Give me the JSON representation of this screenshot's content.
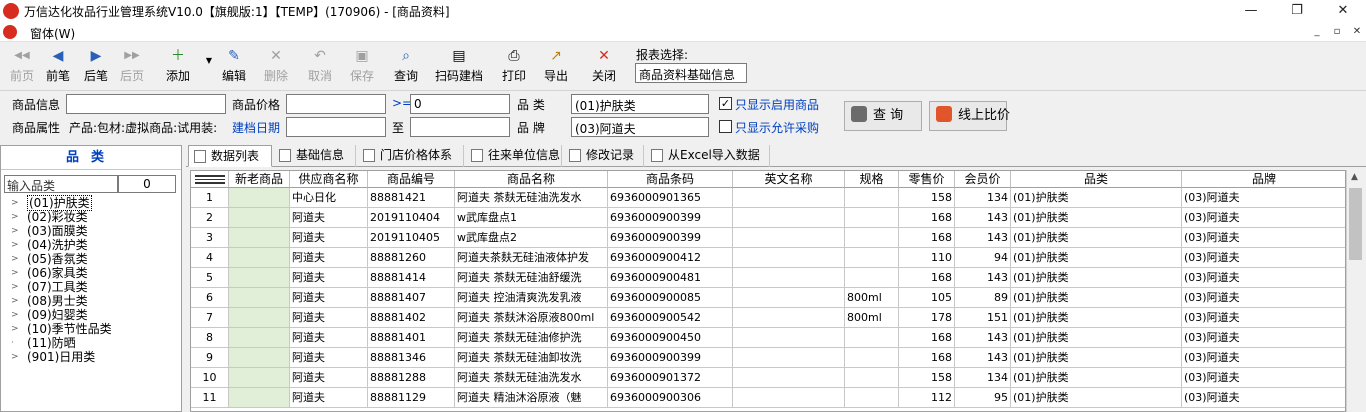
{
  "window": {
    "title": "万信达化妆品行业管理系统V10.0【旗舰版:1】【TEMP】(170906) - [商品资料]",
    "menu": "窗体(W)"
  },
  "toolbar": {
    "buttons": [
      {
        "label": "前页",
        "icon": "◀◀",
        "enabled": false
      },
      {
        "label": "前笔",
        "icon": "◀",
        "enabled": true
      },
      {
        "label": "后笔",
        "icon": "▶",
        "enabled": true
      },
      {
        "label": "后页",
        "icon": "▶▶",
        "enabled": false
      },
      {
        "label": "添加",
        "icon": "＋",
        "enabled": true
      },
      {
        "label": "编辑",
        "icon": "✎",
        "enabled": true
      },
      {
        "label": "删除",
        "icon": "✕",
        "enabled": false
      },
      {
        "label": "取消",
        "icon": "↶",
        "enabled": false
      },
      {
        "label": "保存",
        "icon": "▣",
        "enabled": false
      },
      {
        "label": "查询",
        "icon": "⌕",
        "enabled": true
      },
      {
        "label": "扫码建档",
        "icon": "▤",
        "enabled": true
      },
      {
        "label": "打印",
        "icon": "⎙",
        "enabled": true
      },
      {
        "label": "导出",
        "icon": "↗",
        "enabled": true
      },
      {
        "label": "关闭",
        "icon": "✕",
        "enabled": true
      }
    ],
    "report_label": "报表选择:",
    "report_value": "商品资料基础信息"
  },
  "filter": {
    "product_info_label": "商品信息",
    "product_info_value": "",
    "price_label": "商品价格",
    "price_value": "",
    "price_op": ">=",
    "price_min": "0",
    "category_label": "品      类",
    "category_value": "(01)护肤类",
    "only_enabled_label": "只显示启用商品",
    "only_enabled_checked": true,
    "attr_label": "商品属性",
    "attr_value": "产品:包材:虚拟商品:试用装:",
    "created_label": "建档日期",
    "created_from": "",
    "to_label": "至",
    "created_to": "",
    "brand_label": "品      牌",
    "brand_value": "(03)阿道夫",
    "only_purchase_label": "只显示允许采购",
    "only_purchase_checked": false,
    "query_button": "查  询",
    "compare_button": "线上比价"
  },
  "category_tree": {
    "header": "品类",
    "search_placeholder": "输入品类",
    "count": "0",
    "items": [
      {
        "label": "(01)护肤类",
        "selected": true,
        "expandable": true
      },
      {
        "label": "(02)彩妆类",
        "selected": false,
        "expandable": true
      },
      {
        "label": "(03)面膜类",
        "selected": false,
        "expandable": true
      },
      {
        "label": "(04)洗护类",
        "selected": false,
        "expandable": true
      },
      {
        "label": "(05)香氛类",
        "selected": false,
        "expandable": true
      },
      {
        "label": "(06)家具类",
        "selected": false,
        "expandable": true
      },
      {
        "label": "(07)工具类",
        "selected": false,
        "expandable": true
      },
      {
        "label": "(08)男士类",
        "selected": false,
        "expandable": true
      },
      {
        "label": "(09)妇婴类",
        "selected": false,
        "expandable": true
      },
      {
        "label": "(10)季节性品类",
        "selected": false,
        "expandable": true
      },
      {
        "label": "(11)防晒",
        "selected": false,
        "expandable": false
      },
      {
        "label": "(901)日用类",
        "selected": false,
        "expandable": true
      }
    ]
  },
  "tabs": [
    {
      "label": "数据列表",
      "active": true
    },
    {
      "label": "基础信息",
      "active": false
    },
    {
      "label": "门店价格体系",
      "active": false
    },
    {
      "label": "往来单位信息",
      "active": false
    },
    {
      "label": "修改记录",
      "active": false
    },
    {
      "label": "从Excel导入数据",
      "active": false
    }
  ],
  "table": {
    "columns": [
      "",
      "新老商品",
      "供应商名称",
      "商品编号",
      "商品名称",
      "商品条码",
      "英文名称",
      "规格",
      "零售价",
      "会员价",
      "品类",
      "品牌"
    ],
    "rows": [
      [
        "1",
        "",
        "中心日化",
        "88881421",
        "阿道夫 茶麸无硅油洗发水",
        "6936000901365",
        "",
        "",
        "158",
        "134",
        "(01)护肤类",
        "(03)阿道夫"
      ],
      [
        "2",
        "",
        "阿道夫",
        "2019110404",
        "w武库盘点1",
        "6936000900399",
        "",
        "",
        "168",
        "143",
        "(01)护肤类",
        "(03)阿道夫"
      ],
      [
        "3",
        "",
        "阿道夫",
        "2019110405",
        "w武库盘点2",
        "6936000900399",
        "",
        "",
        "168",
        "143",
        "(01)护肤类",
        "(03)阿道夫"
      ],
      [
        "4",
        "",
        "阿道夫",
        "88881260",
        "阿道夫茶麸无硅油液体护发",
        "6936000900412",
        "",
        "",
        "110",
        "94",
        "(01)护肤类",
        "(03)阿道夫"
      ],
      [
        "5",
        "",
        "阿道夫",
        "88881414",
        "阿道夫 茶麸无硅油舒缓洗",
        "6936000900481",
        "",
        "",
        "168",
        "143",
        "(01)护肤类",
        "(03)阿道夫"
      ],
      [
        "6",
        "",
        "阿道夫",
        "88881407",
        "阿道夫 控油清爽洗发乳液",
        "6936000900085",
        "",
        "800ml",
        "105",
        "89",
        "(01)护肤类",
        "(03)阿道夫"
      ],
      [
        "7",
        "",
        "阿道夫",
        "88881402",
        "阿道夫 茶麸沐浴原液800ml",
        "6936000900542",
        "",
        "800ml",
        "178",
        "151",
        "(01)护肤类",
        "(03)阿道夫"
      ],
      [
        "8",
        "",
        "阿道夫",
        "88881401",
        "阿道夫 茶麸无硅油修护洗",
        "6936000900450",
        "",
        "",
        "168",
        "143",
        "(01)护肤类",
        "(03)阿道夫"
      ],
      [
        "9",
        "",
        "阿道夫",
        "88881346",
        "阿道夫 茶麸无硅油卸妆洗",
        "6936000900399",
        "",
        "",
        "168",
        "143",
        "(01)护肤类",
        "(03)阿道夫"
      ],
      [
        "10",
        "",
        "阿道夫",
        "88881288",
        "阿道夫 茶麸无硅油洗发水",
        "6936000901372",
        "",
        "",
        "158",
        "134",
        "(01)护肤类",
        "(03)阿道夫"
      ],
      [
        "11",
        "",
        "阿道夫",
        "88881129",
        "阿道夫 精油沐浴原液（魅",
        "6936000900306",
        "",
        "",
        "112",
        "95",
        "(01)护肤类",
        "(03)阿道夫"
      ]
    ]
  },
  "colors": {
    "accent_blue": "#0040c0",
    "new_old_cell": "#e1eed8",
    "close_red": "#d62d20"
  }
}
